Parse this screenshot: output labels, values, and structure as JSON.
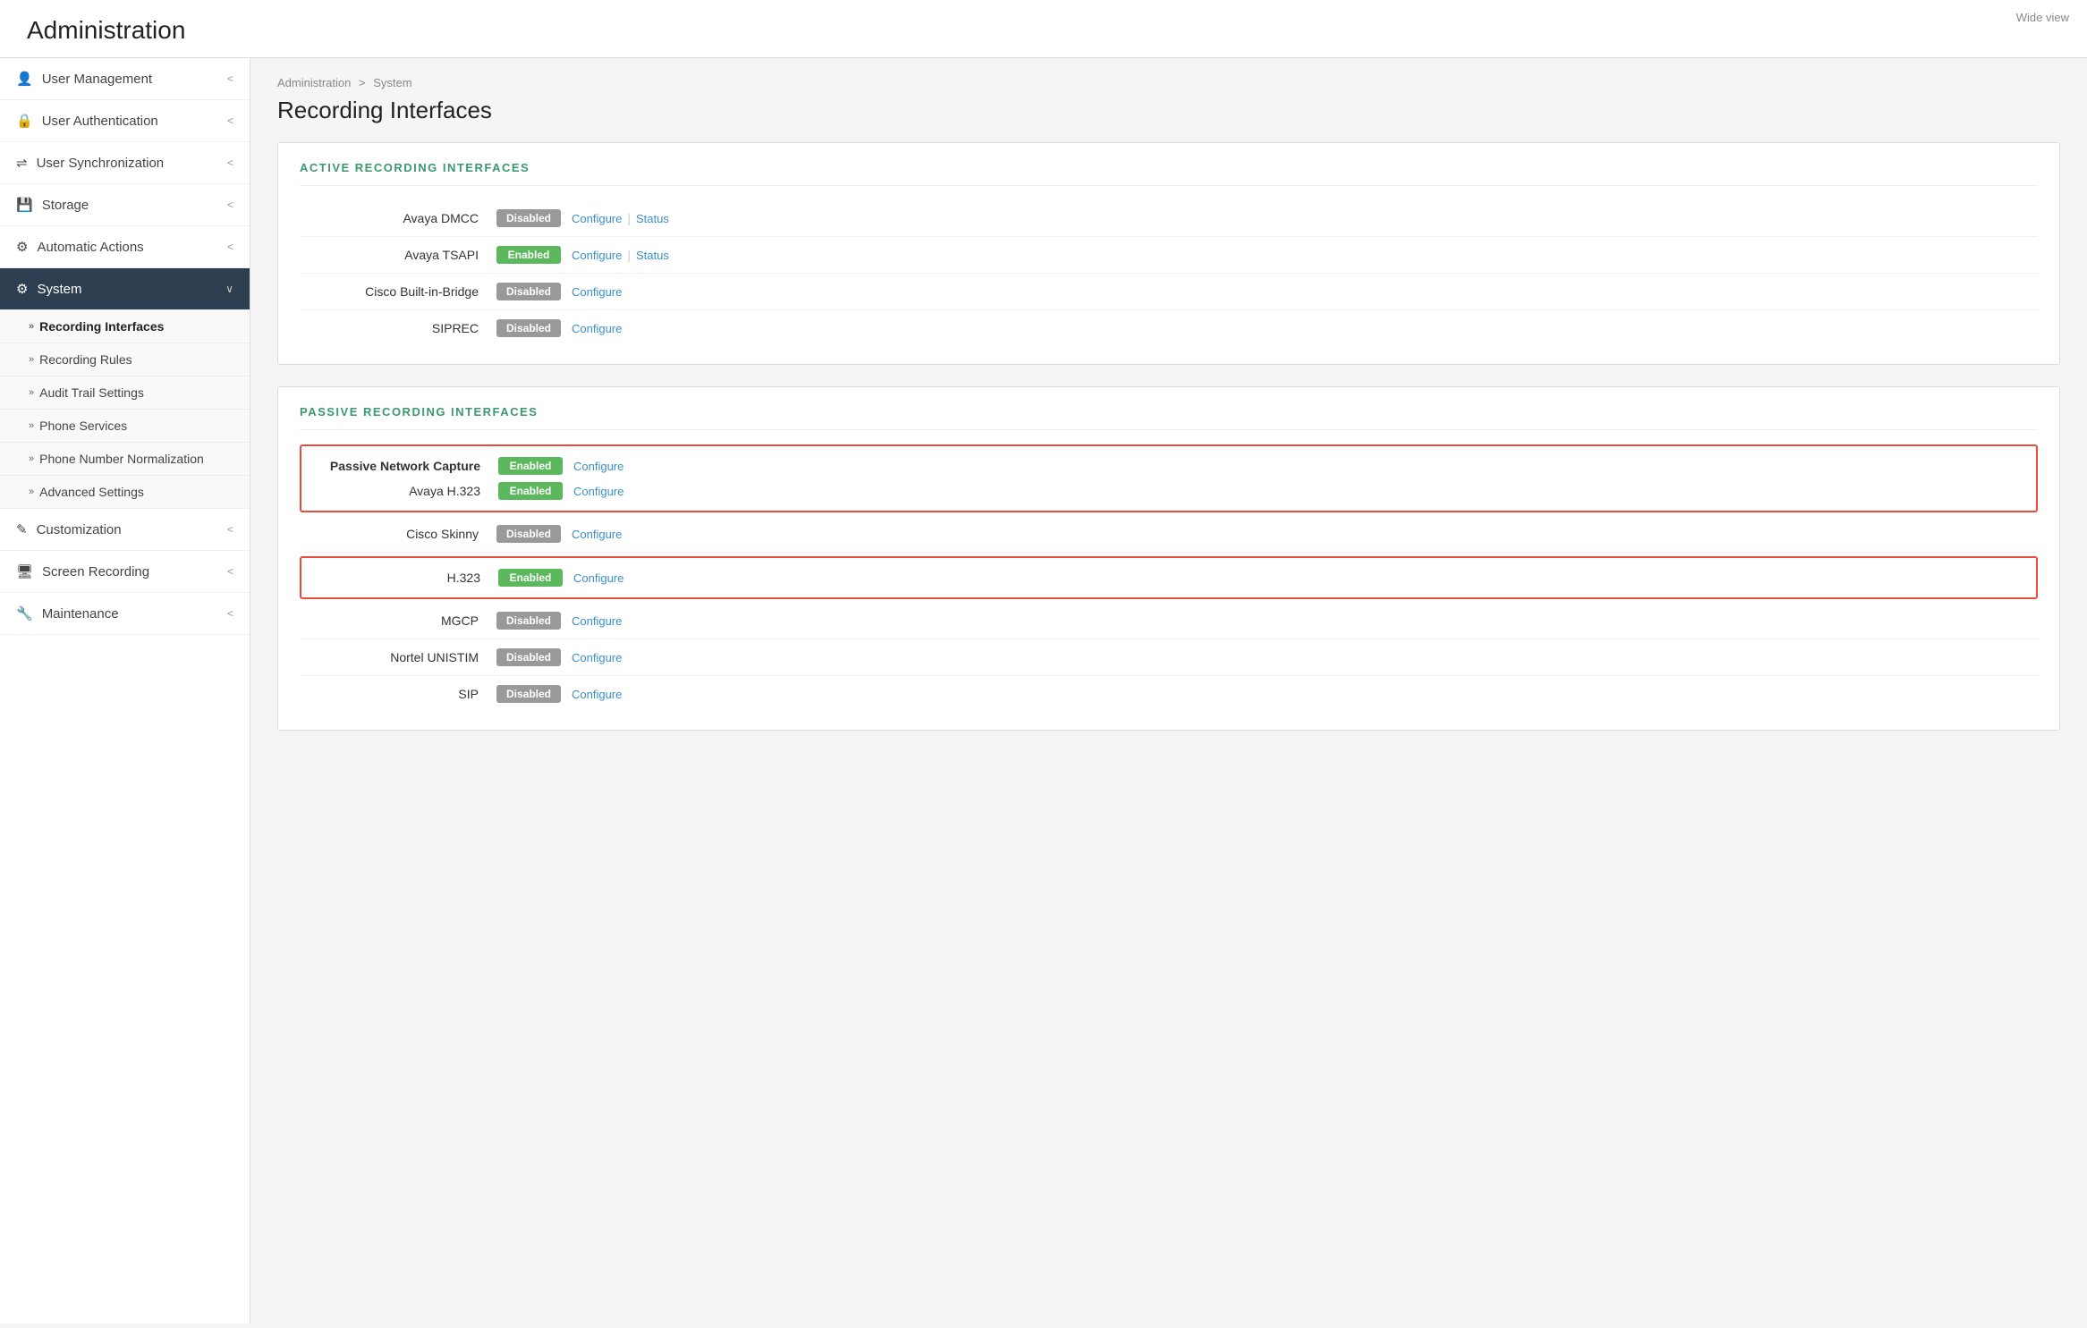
{
  "wide_view": "Wide view",
  "page_title": "Administration",
  "breadcrumb": {
    "parent": "Administration",
    "sep": ">",
    "current": "System"
  },
  "content_title": "Recording Interfaces",
  "sidebar": {
    "items": [
      {
        "id": "user-management",
        "icon": "👤",
        "label": "User Management",
        "chevron": "<"
      },
      {
        "id": "user-authentication",
        "icon": "🔒",
        "label": "User Authentication",
        "chevron": "<"
      },
      {
        "id": "user-synchronization",
        "icon": "⇌",
        "label": "User Synchronization",
        "chevron": "<"
      },
      {
        "id": "storage",
        "icon": "💾",
        "label": "Storage",
        "chevron": "<"
      },
      {
        "id": "automatic-actions",
        "icon": "⚙",
        "label": "Automatic Actions",
        "chevron": "<"
      },
      {
        "id": "system",
        "icon": "⚙",
        "label": "System",
        "chevron": "∨",
        "active": true
      }
    ],
    "subitems": [
      {
        "id": "recording-interfaces",
        "label": "Recording Interfaces",
        "active": true
      },
      {
        "id": "recording-rules",
        "label": "Recording Rules"
      },
      {
        "id": "audit-trail-settings",
        "label": "Audit Trail Settings"
      },
      {
        "id": "phone-services",
        "label": "Phone Services"
      },
      {
        "id": "phone-number-normalization",
        "label": "Phone Number Normalization"
      },
      {
        "id": "advanced-settings",
        "label": "Advanced Settings"
      }
    ],
    "bottom_items": [
      {
        "id": "customization",
        "icon": "✎",
        "label": "Customization",
        "chevron": "<"
      },
      {
        "id": "screen-recording",
        "icon": "🖥",
        "label": "Screen Recording",
        "chevron": "<"
      },
      {
        "id": "maintenance",
        "icon": "🔧",
        "label": "Maintenance",
        "chevron": "<"
      }
    ]
  },
  "active_section": {
    "heading": "ACTIVE RECORDING INTERFACES",
    "interfaces": [
      {
        "name": "Avaya DMCC",
        "status": "Disabled",
        "enabled": false,
        "actions": [
          "Configure",
          "Status"
        ]
      },
      {
        "name": "Avaya TSAPI",
        "status": "Enabled",
        "enabled": true,
        "actions": [
          "Configure",
          "Status"
        ]
      },
      {
        "name": "Cisco Built-in-Bridge",
        "status": "Disabled",
        "enabled": false,
        "actions": [
          "Configure"
        ]
      },
      {
        "name": "SIPREC",
        "status": "Disabled",
        "enabled": false,
        "actions": [
          "Configure"
        ]
      }
    ]
  },
  "passive_section": {
    "heading": "PASSIVE RECORDING INTERFACES",
    "groups": [
      {
        "highlighted": true,
        "interfaces": [
          {
            "name": "Passive Network Capture",
            "bold": true,
            "status": "Enabled",
            "enabled": true,
            "actions": [
              "Configure"
            ]
          },
          {
            "name": "Avaya H.323",
            "bold": false,
            "status": "Enabled",
            "enabled": true,
            "actions": [
              "Configure"
            ]
          }
        ]
      },
      {
        "highlighted": false,
        "interfaces": [
          {
            "name": "Cisco Skinny",
            "bold": false,
            "status": "Disabled",
            "enabled": false,
            "actions": [
              "Configure"
            ]
          }
        ]
      },
      {
        "highlighted": true,
        "interfaces": [
          {
            "name": "H.323",
            "bold": false,
            "status": "Enabled",
            "enabled": true,
            "actions": [
              "Configure"
            ]
          }
        ]
      },
      {
        "highlighted": false,
        "interfaces": [
          {
            "name": "MGCP",
            "bold": false,
            "status": "Disabled",
            "enabled": false,
            "actions": [
              "Configure"
            ]
          },
          {
            "name": "Nortel UNISTIM",
            "bold": false,
            "status": "Disabled",
            "enabled": false,
            "actions": [
              "Configure"
            ]
          },
          {
            "name": "SIP",
            "bold": false,
            "status": "Disabled",
            "enabled": false,
            "actions": [
              "Configure"
            ]
          }
        ]
      }
    ]
  }
}
